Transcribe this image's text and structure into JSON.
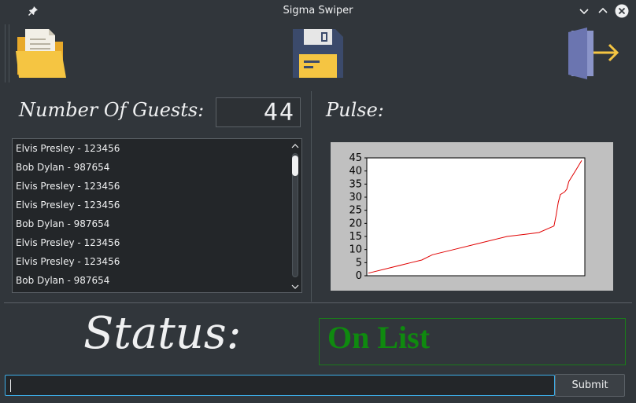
{
  "window": {
    "title": "Sigma Swiper"
  },
  "toolbar": {
    "open": "folder-icon",
    "save": "floppy-disk-icon",
    "exit": "exit-door-icon"
  },
  "guests": {
    "label": "Number Of Guests:",
    "count": "44"
  },
  "list": {
    "items": [
      "Elvis Presley - 123456",
      "Bob Dylan - 987654",
      "Elvis Presley - 123456",
      "Elvis Presley - 123456",
      "Bob Dylan - 987654",
      "Elvis Presley - 123456",
      "Elvis Presley - 123456",
      "Bob Dylan - 987654"
    ]
  },
  "pulse": {
    "label": "Pulse:"
  },
  "chart_data": {
    "type": "line",
    "title": "",
    "xlabel": "",
    "ylabel": "",
    "ylim": [
      0,
      45
    ],
    "yticks": [
      "45",
      "40",
      "35",
      "30",
      "25",
      "20",
      "15",
      "10",
      "5",
      "0"
    ],
    "grid": false,
    "series": [
      {
        "color": "#e00000",
        "x": [
          0,
          10,
          20,
          25,
          30,
          40,
          50,
          65,
          75,
          80,
          87,
          88,
          89,
          90,
          91,
          92,
          93,
          94,
          97,
          100
        ],
        "y": [
          1,
          3,
          5,
          6,
          8,
          10,
          12,
          15,
          16,
          16.5,
          19,
          23,
          28,
          31,
          31.5,
          32,
          33,
          36,
          40,
          44
        ]
      }
    ],
    "colors": {
      "plot_bg": "#ffffff",
      "frame_bg": "#c0c0c0",
      "line": "#e00000"
    }
  },
  "status": {
    "label": "Status:",
    "value": "On List",
    "value_color": "#0f8a0f"
  },
  "input": {
    "value": ""
  },
  "submit": {
    "label": "Submit"
  }
}
